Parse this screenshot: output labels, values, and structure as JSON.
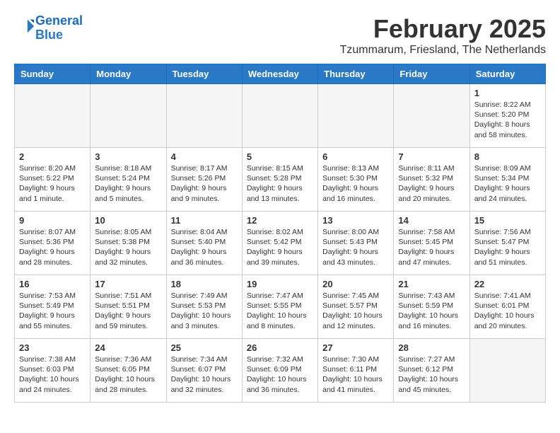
{
  "logo": {
    "line1": "General",
    "line2": "Blue"
  },
  "title": "February 2025",
  "subtitle": "Tzummarum, Friesland, The Netherlands",
  "days_of_week": [
    "Sunday",
    "Monday",
    "Tuesday",
    "Wednesday",
    "Thursday",
    "Friday",
    "Saturday"
  ],
  "weeks": [
    [
      {
        "day": "",
        "info": ""
      },
      {
        "day": "",
        "info": ""
      },
      {
        "day": "",
        "info": ""
      },
      {
        "day": "",
        "info": ""
      },
      {
        "day": "",
        "info": ""
      },
      {
        "day": "",
        "info": ""
      },
      {
        "day": "1",
        "info": "Sunrise: 8:22 AM\nSunset: 5:20 PM\nDaylight: 8 hours and 58 minutes."
      }
    ],
    [
      {
        "day": "2",
        "info": "Sunrise: 8:20 AM\nSunset: 5:22 PM\nDaylight: 9 hours and 1 minute."
      },
      {
        "day": "3",
        "info": "Sunrise: 8:18 AM\nSunset: 5:24 PM\nDaylight: 9 hours and 5 minutes."
      },
      {
        "day": "4",
        "info": "Sunrise: 8:17 AM\nSunset: 5:26 PM\nDaylight: 9 hours and 9 minutes."
      },
      {
        "day": "5",
        "info": "Sunrise: 8:15 AM\nSunset: 5:28 PM\nDaylight: 9 hours and 13 minutes."
      },
      {
        "day": "6",
        "info": "Sunrise: 8:13 AM\nSunset: 5:30 PM\nDaylight: 9 hours and 16 minutes."
      },
      {
        "day": "7",
        "info": "Sunrise: 8:11 AM\nSunset: 5:32 PM\nDaylight: 9 hours and 20 minutes."
      },
      {
        "day": "8",
        "info": "Sunrise: 8:09 AM\nSunset: 5:34 PM\nDaylight: 9 hours and 24 minutes."
      }
    ],
    [
      {
        "day": "9",
        "info": "Sunrise: 8:07 AM\nSunset: 5:36 PM\nDaylight: 9 hours and 28 minutes."
      },
      {
        "day": "10",
        "info": "Sunrise: 8:05 AM\nSunset: 5:38 PM\nDaylight: 9 hours and 32 minutes."
      },
      {
        "day": "11",
        "info": "Sunrise: 8:04 AM\nSunset: 5:40 PM\nDaylight: 9 hours and 36 minutes."
      },
      {
        "day": "12",
        "info": "Sunrise: 8:02 AM\nSunset: 5:42 PM\nDaylight: 9 hours and 39 minutes."
      },
      {
        "day": "13",
        "info": "Sunrise: 8:00 AM\nSunset: 5:43 PM\nDaylight: 9 hours and 43 minutes."
      },
      {
        "day": "14",
        "info": "Sunrise: 7:58 AM\nSunset: 5:45 PM\nDaylight: 9 hours and 47 minutes."
      },
      {
        "day": "15",
        "info": "Sunrise: 7:56 AM\nSunset: 5:47 PM\nDaylight: 9 hours and 51 minutes."
      }
    ],
    [
      {
        "day": "16",
        "info": "Sunrise: 7:53 AM\nSunset: 5:49 PM\nDaylight: 9 hours and 55 minutes."
      },
      {
        "day": "17",
        "info": "Sunrise: 7:51 AM\nSunset: 5:51 PM\nDaylight: 9 hours and 59 minutes."
      },
      {
        "day": "18",
        "info": "Sunrise: 7:49 AM\nSunset: 5:53 PM\nDaylight: 10 hours and 3 minutes."
      },
      {
        "day": "19",
        "info": "Sunrise: 7:47 AM\nSunset: 5:55 PM\nDaylight: 10 hours and 8 minutes."
      },
      {
        "day": "20",
        "info": "Sunrise: 7:45 AM\nSunset: 5:57 PM\nDaylight: 10 hours and 12 minutes."
      },
      {
        "day": "21",
        "info": "Sunrise: 7:43 AM\nSunset: 5:59 PM\nDaylight: 10 hours and 16 minutes."
      },
      {
        "day": "22",
        "info": "Sunrise: 7:41 AM\nSunset: 6:01 PM\nDaylight: 10 hours and 20 minutes."
      }
    ],
    [
      {
        "day": "23",
        "info": "Sunrise: 7:38 AM\nSunset: 6:03 PM\nDaylight: 10 hours and 24 minutes."
      },
      {
        "day": "24",
        "info": "Sunrise: 7:36 AM\nSunset: 6:05 PM\nDaylight: 10 hours and 28 minutes."
      },
      {
        "day": "25",
        "info": "Sunrise: 7:34 AM\nSunset: 6:07 PM\nDaylight: 10 hours and 32 minutes."
      },
      {
        "day": "26",
        "info": "Sunrise: 7:32 AM\nSunset: 6:09 PM\nDaylight: 10 hours and 36 minutes."
      },
      {
        "day": "27",
        "info": "Sunrise: 7:30 AM\nSunset: 6:11 PM\nDaylight: 10 hours and 41 minutes."
      },
      {
        "day": "28",
        "info": "Sunrise: 7:27 AM\nSunset: 6:12 PM\nDaylight: 10 hours and 45 minutes."
      },
      {
        "day": "",
        "info": ""
      }
    ]
  ]
}
